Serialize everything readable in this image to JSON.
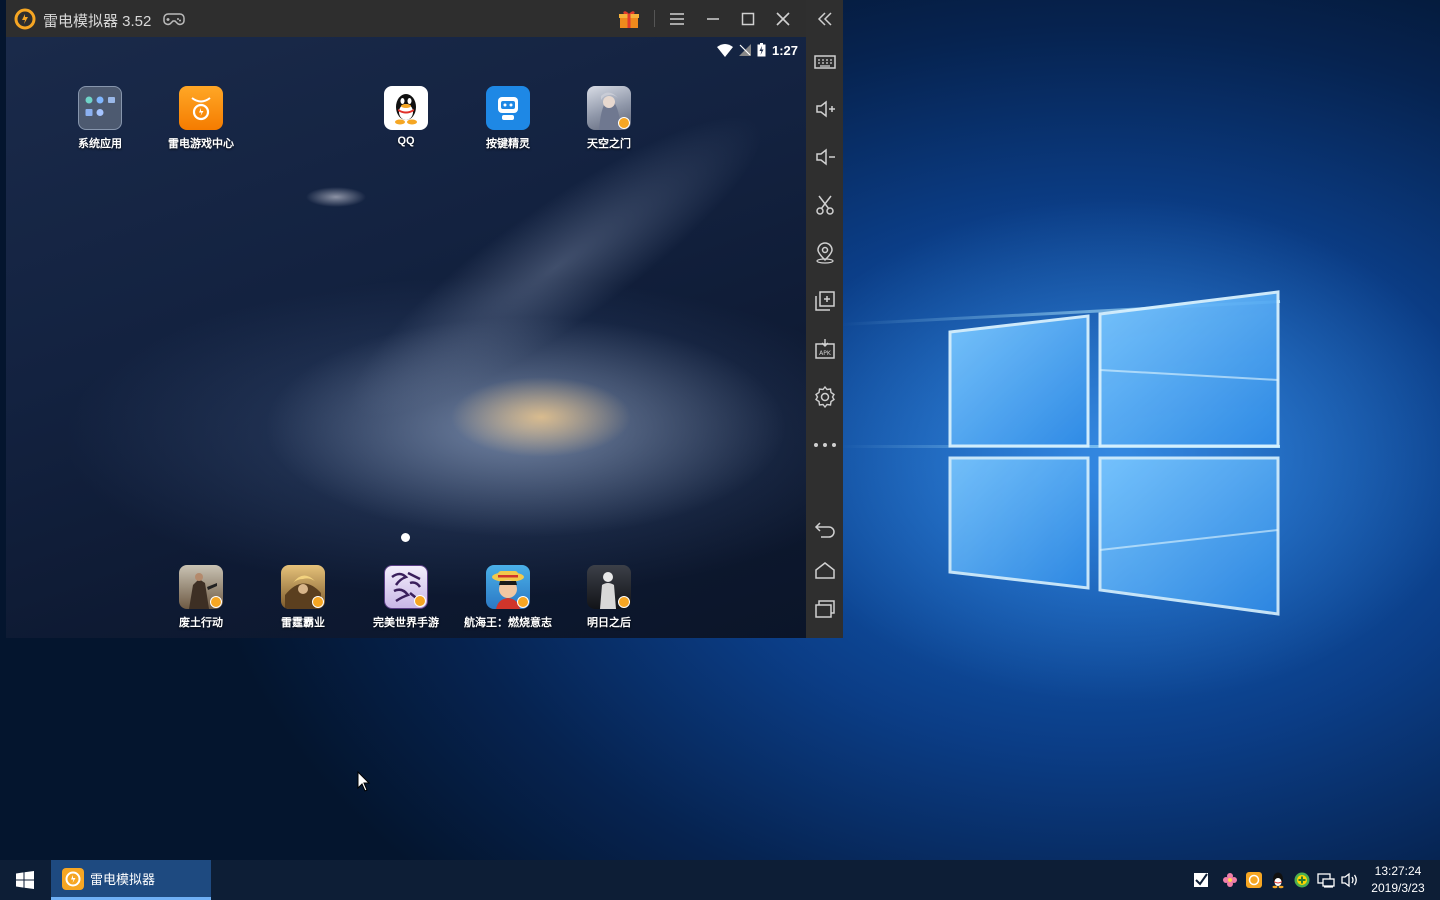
{
  "emulator": {
    "title": "雷电模拟器 3.52",
    "status_time": "1:27",
    "apps_top": [
      {
        "label": "系统应用",
        "icon": "system-apps-folder-icon"
      },
      {
        "label": "雷电游戏中心",
        "icon": "leidian-game-center-icon"
      },
      {
        "label": "QQ",
        "icon": "qq-penguin-icon"
      },
      {
        "label": "按键精灵",
        "icon": "key-wizard-robot-icon"
      },
      {
        "label": "天空之门",
        "icon": "sky-gate-game-icon"
      }
    ],
    "apps_dock": [
      {
        "label": "废土行动",
        "icon": "wasteland-game-icon"
      },
      {
        "label": "雷霆霸业",
        "icon": "thunder-empire-game-icon"
      },
      {
        "label": "完美世界手游",
        "icon": "perfect-world-game-icon"
      },
      {
        "label": "航海王：燃烧意志",
        "icon": "one-piece-game-icon"
      },
      {
        "label": "明日之后",
        "icon": "life-after-game-icon"
      }
    ],
    "sidebar_buttons": [
      "keyboard-icon",
      "volume-up-icon",
      "volume-down-icon",
      "scissors-icon",
      "location-icon",
      "multi-instance-icon",
      "apk-install-icon",
      "settings-icon",
      "more-icon",
      "back-icon",
      "home-icon",
      "recent-apps-icon"
    ]
  },
  "taskbar": {
    "app_label": "雷电模拟器",
    "time": "13:27:24",
    "date": "2019/3/23"
  },
  "colors": {
    "accent_orange": "#f6a623",
    "taskbar_active": "#1e4a80",
    "desktop_blue": "#1565c4"
  }
}
